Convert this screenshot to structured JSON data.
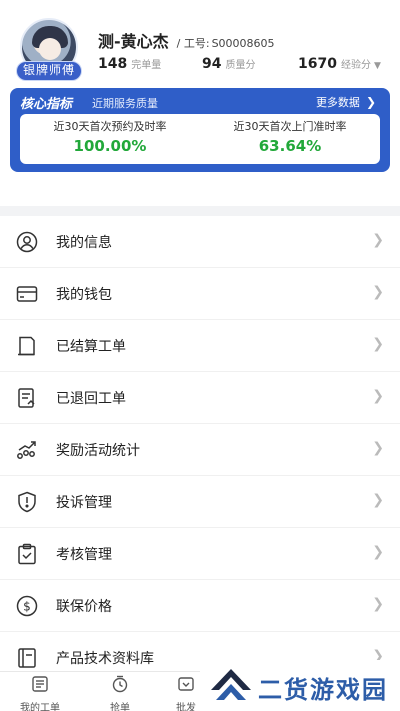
{
  "profile": {
    "badge": "银牌师傅",
    "name": "测-黄心杰",
    "emp_label": "/ 工号:",
    "emp_id": "S00008605",
    "stats": [
      {
        "value": "148",
        "label": "完单量"
      },
      {
        "value": "94",
        "label": "质量分"
      },
      {
        "value": "1670",
        "label": "经验分"
      }
    ]
  },
  "core": {
    "title": "核心指标",
    "subtitle": "近期服务质量",
    "more": "更多数据",
    "metrics": [
      {
        "label": "近30天首次预约及时率",
        "value": "100.00%"
      },
      {
        "label": "近30天首次上门准时率",
        "value": "63.64%"
      }
    ],
    "value_color": "#22a83a",
    "accent": "#2f5ec8"
  },
  "menu": [
    {
      "label": "我的信息",
      "icon": "user-icon"
    },
    {
      "label": "我的钱包",
      "icon": "wallet-icon"
    },
    {
      "label": "已结算工单",
      "icon": "document-icon"
    },
    {
      "label": "已退回工单",
      "icon": "returned-order-icon"
    },
    {
      "label": "奖励活动统计",
      "icon": "stats-chart-icon"
    },
    {
      "label": "投诉管理",
      "icon": "alert-shield-icon"
    },
    {
      "label": "考核管理",
      "icon": "clipboard-icon"
    },
    {
      "label": "联保价格",
      "icon": "dollar-coin-icon"
    },
    {
      "label": "产品技术资料库",
      "icon": "book-icon"
    }
  ],
  "tabs": [
    {
      "label": "我的工单",
      "icon": "work-order-icon"
    },
    {
      "label": "抢单",
      "icon": "grab-order-icon"
    },
    {
      "label": "批发",
      "icon": "wholesale-icon"
    }
  ],
  "watermark": {
    "text": "二货游戏园"
  }
}
